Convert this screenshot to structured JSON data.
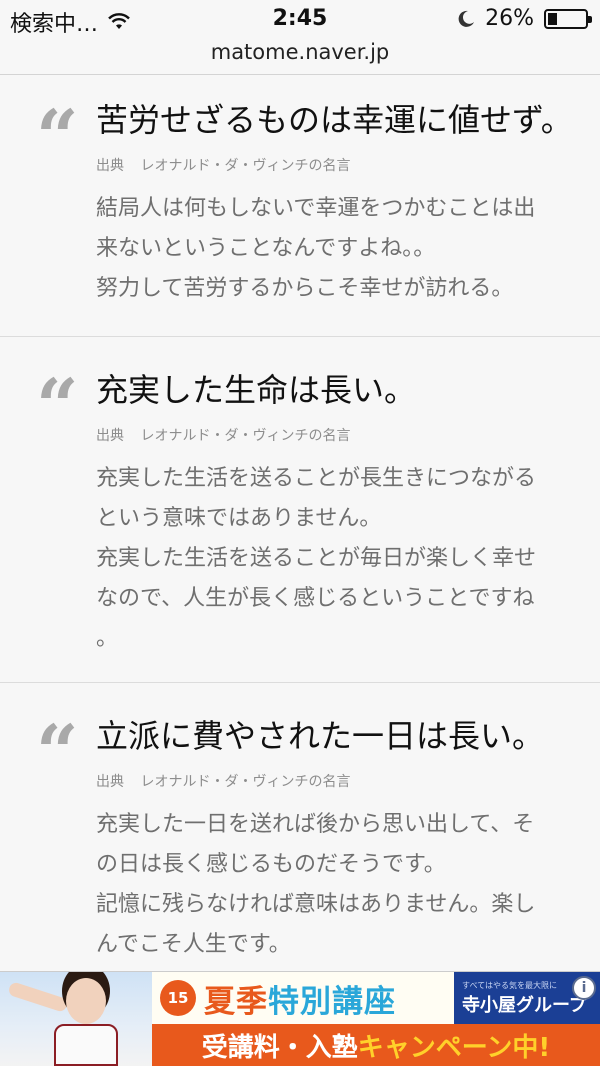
{
  "status_bar": {
    "carrier": "検索中…",
    "time": "2:45",
    "battery_percent": "26%",
    "battery_level": 0.26
  },
  "url_bar": {
    "url": "matome.naver.jp"
  },
  "quotes": [
    {
      "mark": "“",
      "title": "苦労せざるものは幸運に値せず。",
      "source_label": "出典",
      "source": "レオナルド・ダ・ヴィンチの名言",
      "body": [
        "結局人は何もしないで幸運をつかむことは出",
        "来ないということなんですよね。。",
        "努力して苦労するからこそ幸せが訪れる。"
      ]
    },
    {
      "mark": "“",
      "title": "充実した生命は長い。",
      "source_label": "出典",
      "source": "レオナルド・ダ・ヴィンチの名言",
      "body": [
        "充実した生活を送ることが長生きにつながる",
        "という意味ではありません。",
        "充実した生活を送ることが毎日が楽しく幸せ",
        "なので、人生が長く感じるということですね",
        "。"
      ]
    },
    {
      "mark": "“",
      "title": "立派に費やされた一日は長い。",
      "source_label": "出典",
      "source": "レオナルド・ダ・ヴィンチの名言",
      "body": [
        "充実した一日を送れば後から思い出して、そ",
        "の日は長く感じるものだそうです。",
        "記憶に残らなければ意味はありません。楽し",
        "んでこそ人生です。"
      ]
    }
  ],
  "ad": {
    "badge": "15",
    "title_part1": "夏季",
    "title_part2": "特別講座",
    "brand_small": "すべてはやる気を最大限に",
    "brand_name": "寺小屋グループ",
    "info": "i",
    "bottom_part1": "受講料・入塾",
    "bottom_part2": "キャンペーン中!",
    "colors": {
      "orange": "#e8591c",
      "blue": "#2aa7d9",
      "navy": "#1b3f95",
      "yellow": "#ffd12a"
    }
  }
}
